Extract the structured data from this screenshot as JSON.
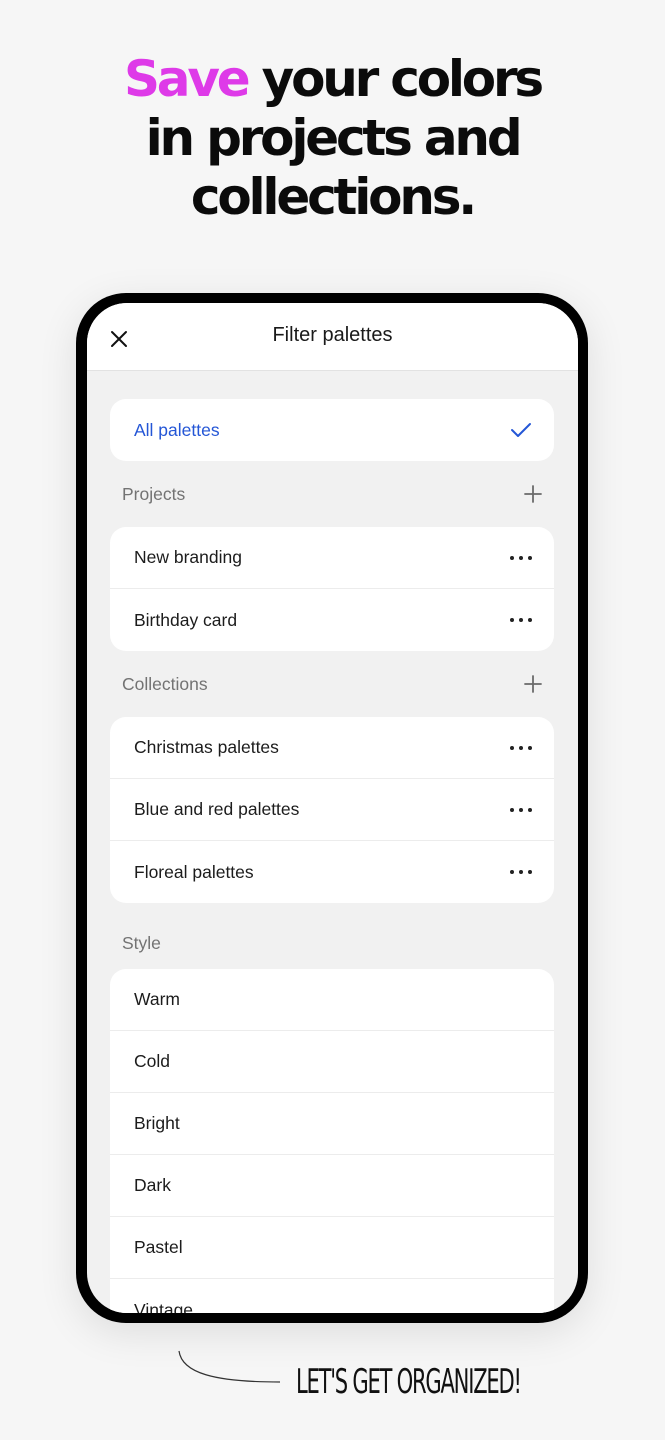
{
  "headline": {
    "accent_word": "Save",
    "line1_rest": " your colors",
    "line2": "in projects and",
    "line3": "collections."
  },
  "colors": {
    "accent": "#de3ae8",
    "selected": "#2456d6",
    "section_label": "#737373",
    "screen_bg": "#f1f1f1"
  },
  "app": {
    "title": "Filter palettes",
    "close_icon": "close-icon",
    "all_palettes": {
      "label": "All palettes",
      "selected": true,
      "icon": "checkmark-icon"
    },
    "sections": {
      "projects": {
        "label": "Projects",
        "add_icon": "plus-icon",
        "items": [
          {
            "label": "New branding",
            "icon": "more-icon"
          },
          {
            "label": "Birthday card",
            "icon": "more-icon"
          }
        ]
      },
      "collections": {
        "label": "Collections",
        "add_icon": "plus-icon",
        "items": [
          {
            "label": "Christmas palettes",
            "icon": "more-icon"
          },
          {
            "label": "Blue and red palettes",
            "icon": "more-icon"
          },
          {
            "label": "Floreal palettes",
            "icon": "more-icon"
          }
        ]
      },
      "style": {
        "label": "Style",
        "items": [
          {
            "label": "Warm"
          },
          {
            "label": "Cold"
          },
          {
            "label": "Bright"
          },
          {
            "label": "Dark"
          },
          {
            "label": "Pastel"
          },
          {
            "label": "Vintage"
          }
        ]
      }
    }
  },
  "tagline": "LET'S GET ORGANIZED!"
}
